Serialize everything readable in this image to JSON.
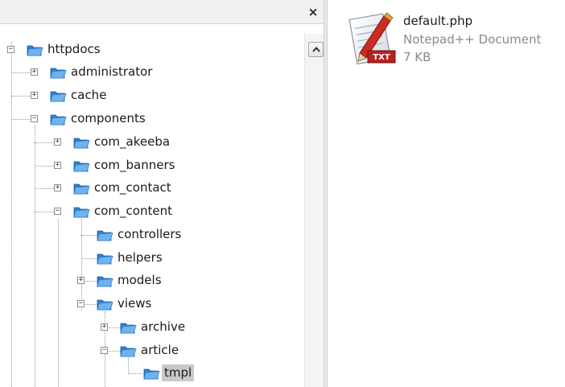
{
  "pane": {
    "close_glyph": "×",
    "scroll_up_icon": "chevron-up-icon"
  },
  "tree": {
    "nodes": [
      {
        "label": "httpdocs",
        "toggle": "−"
      },
      {
        "label": "administrator",
        "toggle": "+"
      },
      {
        "label": "cache",
        "toggle": "+"
      },
      {
        "label": "components",
        "toggle": "−"
      },
      {
        "label": "com_akeeba",
        "toggle": "+"
      },
      {
        "label": "com_banners",
        "toggle": "+"
      },
      {
        "label": "com_contact",
        "toggle": "+"
      },
      {
        "label": "com_content",
        "toggle": "−"
      },
      {
        "label": "controllers",
        "toggle": ""
      },
      {
        "label": "helpers",
        "toggle": ""
      },
      {
        "label": "models",
        "toggle": "+"
      },
      {
        "label": "views",
        "toggle": "−"
      },
      {
        "label": "archive",
        "toggle": "+"
      },
      {
        "label": "article",
        "toggle": "−"
      },
      {
        "label": "tmpl",
        "toggle": ""
      }
    ],
    "selected": "tmpl"
  },
  "file": {
    "name": "default.php",
    "type": "Notepad++ Document",
    "size": "7 KB",
    "badge": "TXT",
    "icon": "notepad-document-icon"
  },
  "colors": {
    "folder_blue": "#3f8fd9",
    "selected_bg": "#c9c9c9",
    "badge_red": "#b8211c"
  }
}
